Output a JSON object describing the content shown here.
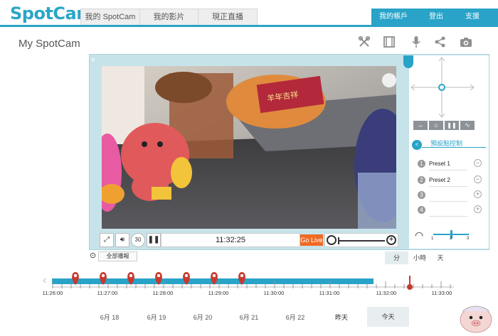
{
  "app": {
    "logo_text": "SpotCam"
  },
  "nav": {
    "tabs": [
      "我的 SpotCam",
      "我的影片",
      "現正直播"
    ],
    "account": [
      "我的帳戶",
      "登出",
      "支援"
    ]
  },
  "page": {
    "title": "My SpotCam"
  },
  "toolbar_icons": [
    "tools-icon",
    "film-icon",
    "microphone-icon",
    "share-icon",
    "camera-icon"
  ],
  "player": {
    "time": "11:32:25",
    "go_live": "Go Live",
    "replay_label": "30"
  },
  "ptz": {
    "title": "預設點控制",
    "presets": [
      {
        "num": "1",
        "label": "Preset 1",
        "action": "−"
      },
      {
        "num": "2",
        "label": "Preset 2",
        "action": "−"
      },
      {
        "num": "3",
        "label": "",
        "action": "+"
      },
      {
        "num": "4",
        "label": "",
        "action": "+"
      }
    ],
    "speed_labels": [
      "1",
      "2",
      "3"
    ],
    "speed_value": 2
  },
  "timeline": {
    "play_all": "全部播報",
    "scales": [
      "分",
      "小時",
      "天"
    ],
    "active_scale": "分",
    "ticks": [
      "11:26:00",
      "11:27:00",
      "11:28:00",
      "11:29:00",
      "11:30:00",
      "11:31:00",
      "11:32:00",
      "11:33:00"
    ],
    "event_count": 7,
    "dates": [
      "6月 18",
      "6月 19",
      "6月 20",
      "6月 21",
      "6月 22",
      "昨天"
    ],
    "today": "今天"
  },
  "colors": {
    "accent": "#29a3c7",
    "golive": "#f06a22",
    "marker": "#c8392f"
  }
}
